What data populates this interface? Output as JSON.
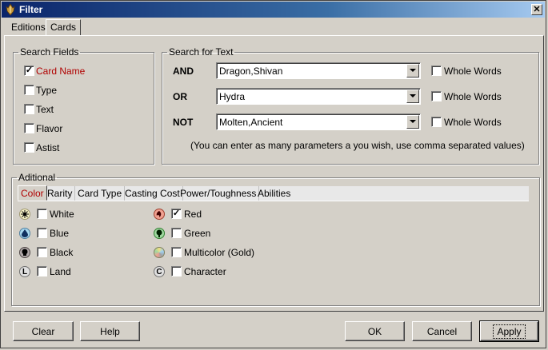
{
  "window": {
    "title": "Filter"
  },
  "tabs": [
    {
      "label": "Editions",
      "active": false
    },
    {
      "label": "Cards",
      "active": true
    }
  ],
  "search_fields": {
    "legend": "Search Fields",
    "items": [
      {
        "label": "Card Name",
        "checked": true
      },
      {
        "label": "Type",
        "checked": false
      },
      {
        "label": "Text",
        "checked": false
      },
      {
        "label": "Flavor",
        "checked": false
      },
      {
        "label": "Astist",
        "checked": false
      }
    ]
  },
  "search_text": {
    "legend": "Search for Text",
    "rows": [
      {
        "op": "AND",
        "value": "Dragon,Shivan",
        "whole_words_label": "Whole Words",
        "whole_words": false
      },
      {
        "op": "OR",
        "value": "Hydra",
        "whole_words_label": "Whole Words",
        "whole_words": false
      },
      {
        "op": "NOT",
        "value": "Molten,Ancient",
        "whole_words_label": "Whole Words",
        "whole_words": false
      }
    ],
    "note": "(You can enter as many parameters a you wish, use comma separated values)"
  },
  "additional": {
    "legend": "Aditional",
    "tabs": [
      {
        "label": "Color",
        "active": true
      },
      {
        "label": "Rarity",
        "active": false
      },
      {
        "label": "Card Type",
        "active": false
      },
      {
        "label": "Casting Cost",
        "active": false
      },
      {
        "label": "Power/Toughness",
        "active": false
      },
      {
        "label": "Abilities",
        "active": false
      }
    ],
    "colors_left": [
      {
        "label": "White",
        "icon": "white-mana-icon",
        "checked": false
      },
      {
        "label": "Blue",
        "icon": "blue-mana-icon",
        "checked": false
      },
      {
        "label": "Black",
        "icon": "black-mana-icon",
        "checked": false
      },
      {
        "label": "Land",
        "icon": "land-icon",
        "symbol": "L",
        "checked": false
      }
    ],
    "colors_right": [
      {
        "label": "Red",
        "icon": "red-mana-icon",
        "checked": true
      },
      {
        "label": "Green",
        "icon": "green-mana-icon",
        "checked": false
      },
      {
        "label": "Multicolor (Gold)",
        "icon": "multicolor-icon",
        "checked": false
      },
      {
        "label": "Character",
        "icon": "colorless-icon",
        "symbol": "C",
        "checked": false
      }
    ]
  },
  "buttons": {
    "clear": "Clear",
    "help": "Help",
    "ok": "OK",
    "cancel": "Cancel",
    "apply": "Apply"
  },
  "colors": {
    "title_start": "#0a246a",
    "title_end": "#a6caf0",
    "face": "#d4d0c8",
    "active_label": "#b00000"
  }
}
